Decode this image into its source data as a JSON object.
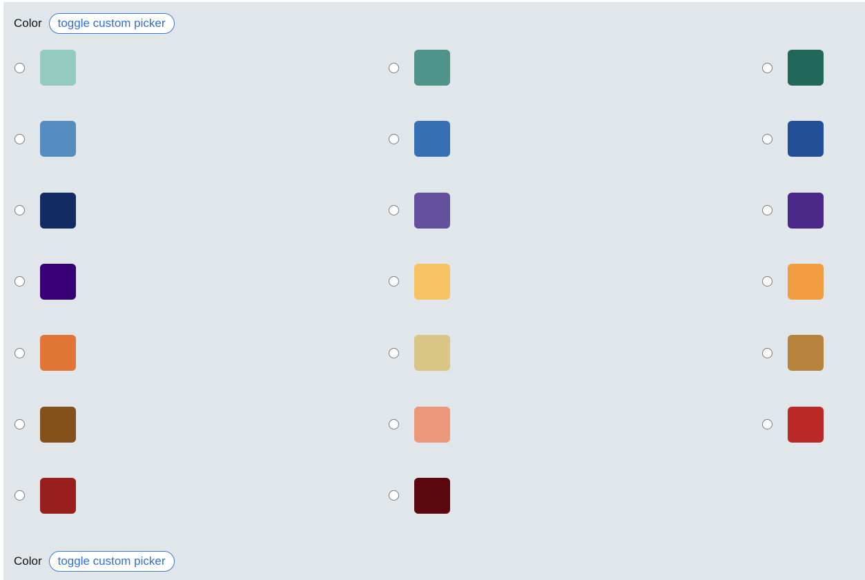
{
  "section_top": {
    "label": "Color",
    "toggle_label": "toggle custom picker"
  },
  "section_bottom": {
    "label": "Color",
    "toggle_label": "toggle custom picker"
  },
  "swatches": [
    {
      "color": "#93cbbf"
    },
    {
      "color": "#50938a"
    },
    {
      "color": "#22685a"
    },
    {
      "color": "#558dc0"
    },
    {
      "color": "#366fb3"
    },
    {
      "color": "#224f98"
    },
    {
      "color": "#122b62"
    },
    {
      "color": "#64509c"
    },
    {
      "color": "#4a2888"
    },
    {
      "color": "#380077"
    },
    {
      "color": "#f5c362"
    },
    {
      "color": "#f29d41"
    },
    {
      "color": "#e17535"
    },
    {
      "color": "#d9c585"
    },
    {
      "color": "#b7823c"
    },
    {
      "color": "#84511d"
    },
    {
      "color": "#ec977a"
    },
    {
      "color": "#bb2a27"
    },
    {
      "color": "#991f1f"
    },
    {
      "color": "#5c070d"
    }
  ],
  "selected_index": null
}
